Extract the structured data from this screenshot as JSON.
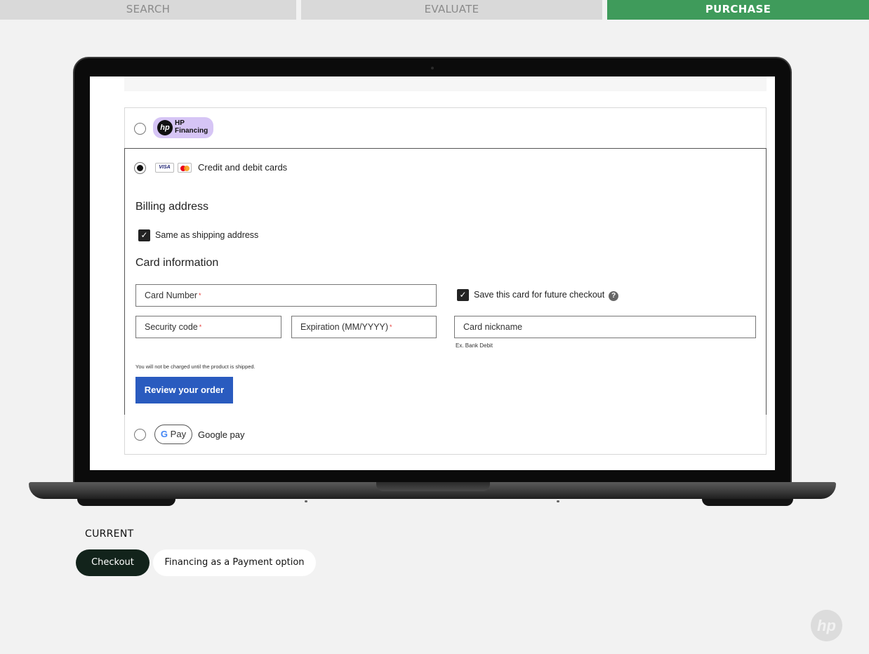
{
  "stages": {
    "search": "SEARCH",
    "evaluate": "EVALUATE",
    "purchase": "PURCHASE"
  },
  "checkout": {
    "hp_financing": {
      "logo_text": "hp",
      "label_line1": "HP",
      "label_line2": "Financing",
      "selected": false
    },
    "cards": {
      "visa_label": "VISA",
      "label": "Credit and debit cards",
      "selected": true
    },
    "billing": {
      "heading": "Billing address",
      "same_as_shipping_label": "Same as shipping address",
      "same_as_shipping_checked": true
    },
    "card_info": {
      "heading": "Card information",
      "card_number_placeholder": "Card Number",
      "security_code_placeholder": "Security code",
      "expiration_placeholder": "Expiration (MM/YYYY)",
      "required_mark": "*",
      "save_card_label": "Save this card for future checkout",
      "save_card_checked": true,
      "help_icon": "?",
      "nickname_placeholder": "Card nickname",
      "nickname_hint": "Ex. Bank Debit"
    },
    "charge_note": "You will not be charged until the product is shipped.",
    "review_button": "Review your order",
    "gpay": {
      "badge_g": "G",
      "badge_pay": "Pay",
      "label": "Google pay",
      "selected": false
    }
  },
  "footer": {
    "current_label": "CURRENT",
    "checkout_pill": "Checkout",
    "financing_pill": "Financing as a Payment option",
    "corner_logo": "hp"
  },
  "colors": {
    "purchase_green": "#3f9b5b",
    "button_blue": "#2a5bbf",
    "hp_financing_purple": "#d6c5f5",
    "dark_pill": "#12231b"
  }
}
